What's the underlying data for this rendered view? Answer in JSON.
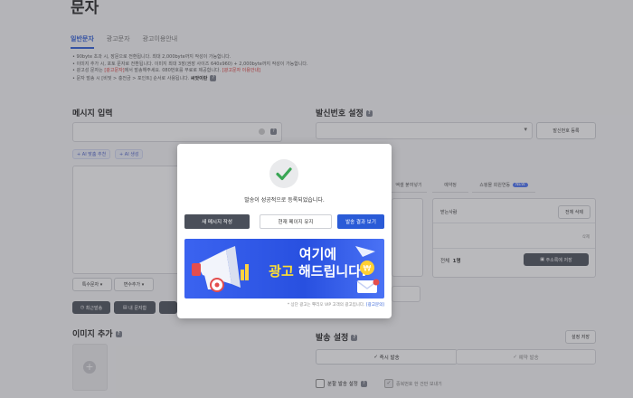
{
  "page": {
    "title": "문자",
    "tabs": [
      "일반문자",
      "광고문자",
      "광고이용안내"
    ]
  },
  "notes": {
    "line1": "• 90byte 초과 시, 장문으로 전환됩니다. 최대 2,000byte까지 작성이 가능합니다.",
    "line2": "• 이미지 추가 시, 포토 문자로 전환됩니다. 이미지 최대 3장(권장 사이즈 640x960) + 2,000byte까지 작성이 가능합니다.",
    "line3_a": "• 광고성 문자는 ",
    "line3_b": "[광고문자]",
    "line3_c": "에서 발송해주세요. 080번호를 무료로 제공합니다. ",
    "line3_d": "[광고문자 이용안내]",
    "line4_a": "• 문자 발송 시 [비및 > 충전금 > 포인트] 순서로 사용됩니다. ",
    "line4_b": "씨앗이란"
  },
  "message": {
    "section_title": "메시지 입력",
    "chip_ai_recommend": "+ AI 맞춤 추천",
    "chip_ai_create": "+ AI 생성",
    "special_chars": "특수문자",
    "variable_add": "변수추가",
    "recent_send": "최근발송",
    "my_messages": "내 문자함"
  },
  "image": {
    "section_title": "이미지 추가"
  },
  "sender": {
    "section_title": "발신번호 설정",
    "register_button": "발신번호 등록"
  },
  "recipients": {
    "tab_paste": "엑셀 붙여넣기",
    "tab_address": "예약정",
    "tab_shop": "쇼핑몰 회원연동",
    "tab_shop_badge": "NEW",
    "recipient_label": "받는사람",
    "delete_all": "전체 삭제",
    "delete_one": "삭제",
    "total_label": "전체",
    "total_count": "1명",
    "save_address": "주소록에 저장"
  },
  "send": {
    "section_title": "발송 설정",
    "settings_save": "설정 저장",
    "instant_send": "즉시 발송",
    "reserved_send": "예약 발송",
    "split_send": "분할 발송 설정",
    "interval_send": "중복번호 한 건만 보내기"
  },
  "modal": {
    "message": "발송이 성공적으로 등록되었습니다.",
    "btn_new": "새 메시지 작성",
    "btn_stay": "현재 페이지 유지",
    "btn_result": "발송 결과 보기",
    "ad_line1_a": "여기에",
    "ad_line2_a": "광고",
    "ad_line2_b": " 해드립니다!",
    "ad_note_a": "* 상단 광고는 뿌리오 VIP 고객의 광고입니다. ",
    "ad_note_b": "[광고문의]"
  },
  "colors": {
    "primary": "#2a5bd7",
    "check": "#3aa655",
    "dark_button": "#4a4f5a"
  }
}
